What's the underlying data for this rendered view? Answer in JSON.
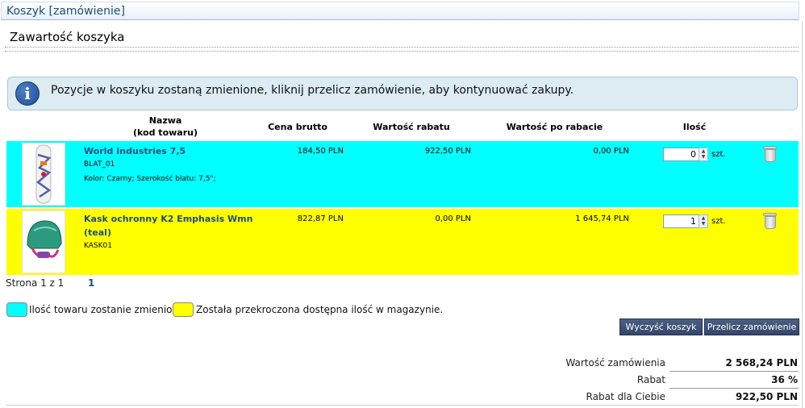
{
  "header": {
    "title": "Koszyk [zamówienie]"
  },
  "section": {
    "title": "Zawartość koszyka"
  },
  "info": {
    "icon": "info-icon",
    "message": "Pozycje w koszyku zostaną zmienione, kliknij przelicz zamówienie, aby kontynuować zakupy."
  },
  "table": {
    "headers": {
      "name": "Nazwa",
      "code": "(kod towaru)",
      "price": "Cena brutto",
      "discount": "Wartość rabatu",
      "after": "Wartość po rabacie",
      "qty": "Ilość"
    },
    "rows": [
      {
        "name": "World Industries 7,5",
        "code": "BLAT_01",
        "attrs": "Kolor: Czarny; Szerokość blatu: 7,5\";",
        "price": "184,50 PLN",
        "discount": "922,50 PLN",
        "after": "0,00 PLN",
        "qty": "0",
        "unit": "szt.",
        "bg": "#00ffff"
      },
      {
        "name": "Kask ochronny K2 Emphasis Wmn",
        "name2": "(teal)",
        "code": "KASK01",
        "price": "822,87 PLN",
        "discount": "0,00 PLN",
        "after": "1 645,74 PLN",
        "qty": "1",
        "unit": "szt.",
        "bg": "#ffff00"
      }
    ]
  },
  "pager": {
    "label": "Strona 1 z 1",
    "page": "1"
  },
  "legend": {
    "cyan_text": "Ilość towaru zostanie zmieniona.",
    "yellow_text": "Została przekroczona dostępna ilość w magazynie.",
    "cyan_color": "#00ffff",
    "yellow_color": "#ffff00"
  },
  "buttons": {
    "clear": "Wyczyść koszyk",
    "recalc": "Przelicz zamówienie"
  },
  "summary": {
    "order_label": "Wartość zamówienia",
    "order_value": "2 568,24 PLN",
    "discount_label": "Rabat",
    "discount_value": "36 %",
    "yours_label": "Rabat dla Ciebie",
    "yours_value": "922,50 PLN"
  }
}
